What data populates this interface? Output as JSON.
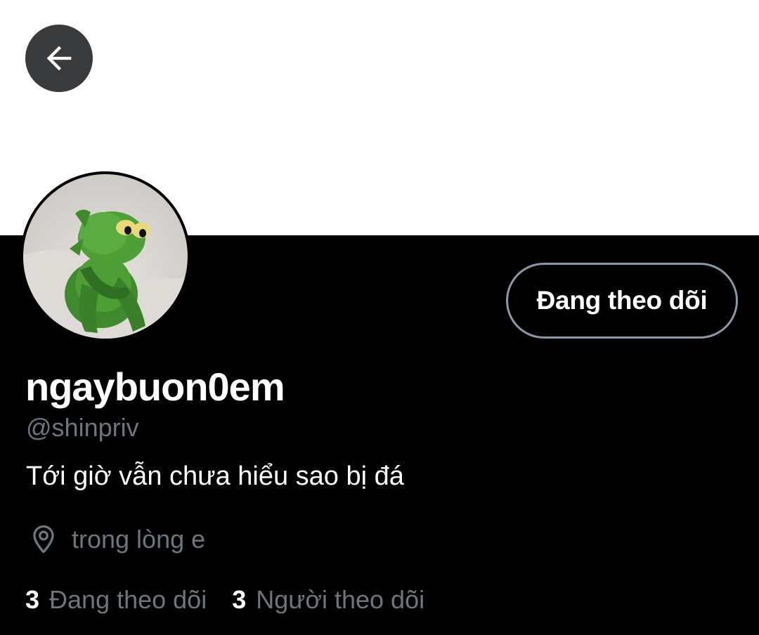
{
  "header": {
    "back_icon": "arrow-left-icon",
    "banner_color": "#ffffff"
  },
  "profile": {
    "avatar": "kermit-frog-sitting-avatar",
    "follow_button_label": "Đang theo dõi",
    "display_name": "ngaybuon0em",
    "handle": "@shinpriv",
    "bio": "Tới giờ vẫn chưa hiểu sao bị đá",
    "location_icon": "location-pin-icon",
    "location": "trong lòng e"
  },
  "stats": {
    "following_count": "3",
    "following_label": "Đang theo dõi",
    "followers_count": "3",
    "followers_label": "Người theo dõi"
  },
  "colors": {
    "background": "#000000",
    "text_primary": "#ffffff",
    "text_secondary": "#6e767d",
    "button_border": "#8b98a5"
  }
}
